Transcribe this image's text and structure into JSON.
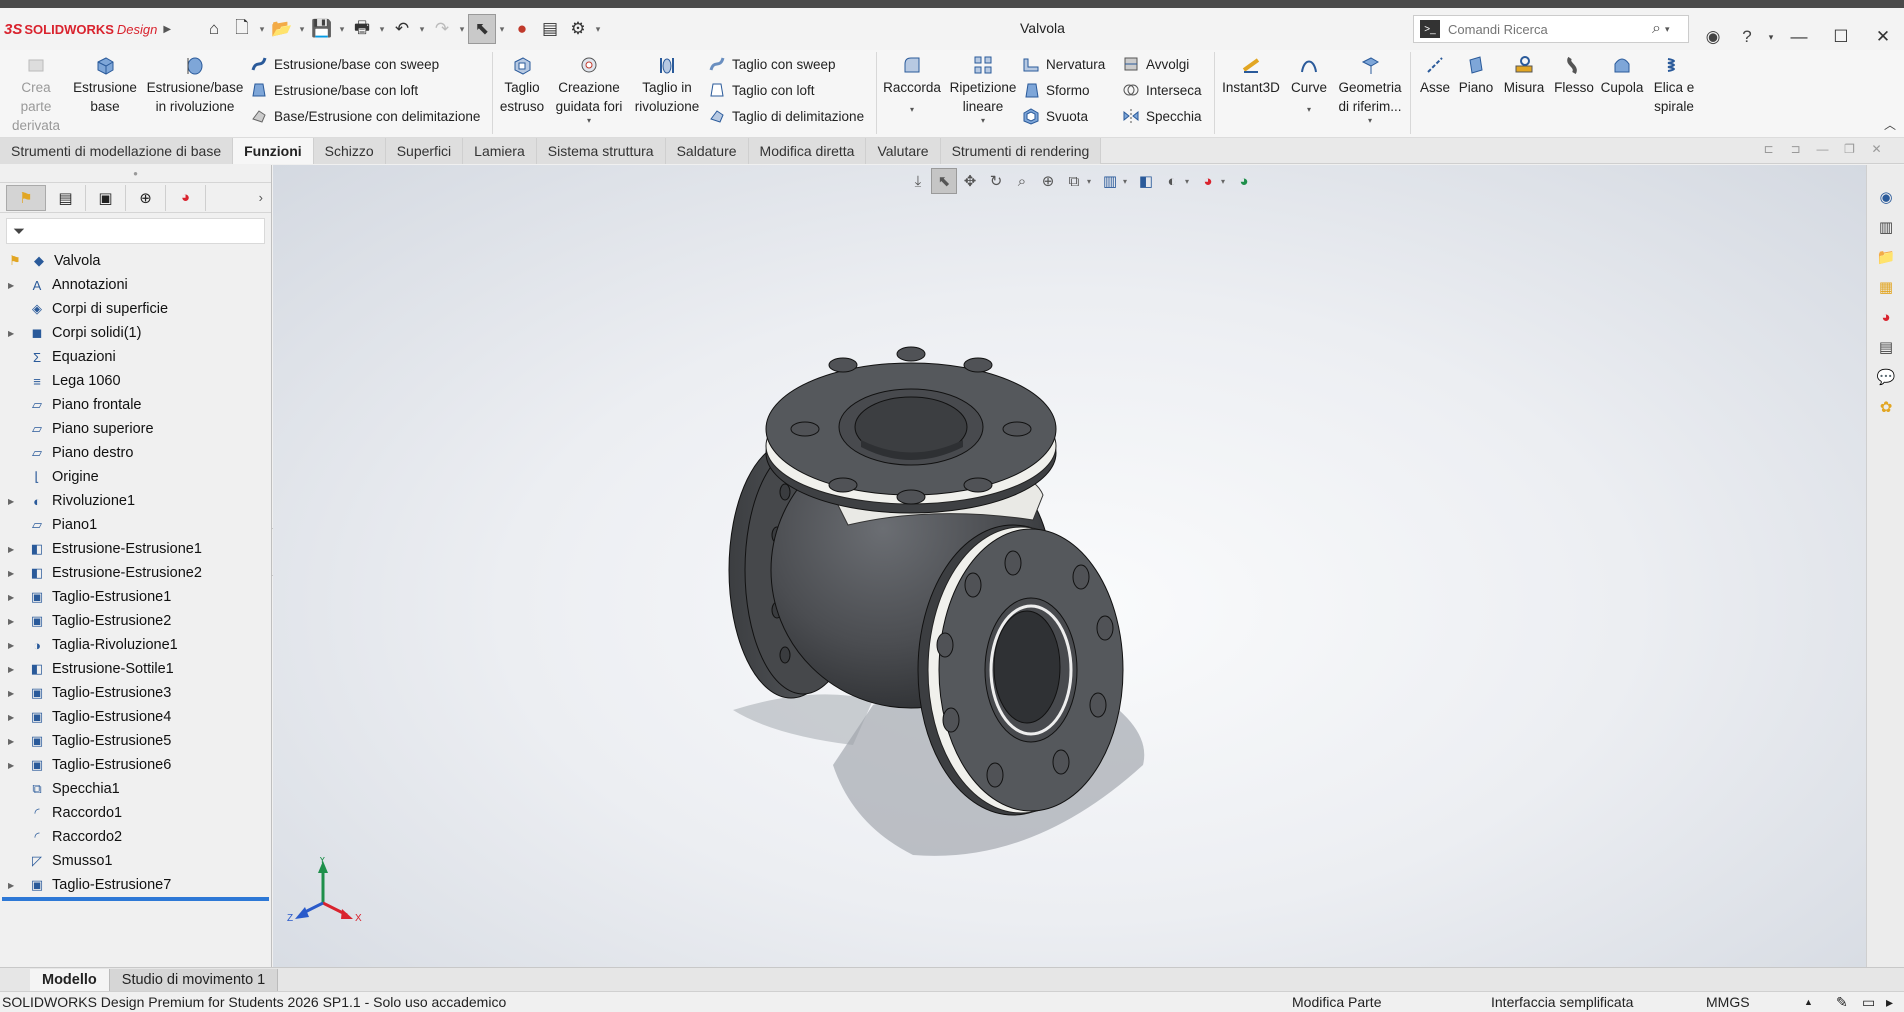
{
  "app": {
    "brand_mark": "3S",
    "brand_name": "SOLIDWORKS",
    "brand_edition": "Design",
    "document_title": "Valvola"
  },
  "search": {
    "placeholder": "Comandi Ricerca"
  },
  "ribbon": {
    "crea_parte": "Crea parte derivata",
    "estrusione_base": "Estrusione base",
    "estrusione_rivoluzione": "Estrusione/base in rivoluzione",
    "estrusione_sweep": "Estrusione/base con sweep",
    "estrusione_loft": "Estrusione/base con loft",
    "base_delimitazione": "Base/Estrusione con delimitazione",
    "taglio_estruso": "Taglio estruso",
    "creazione_fori": "Creazione guidata fori",
    "taglio_rivoluzione": "Taglio in rivoluzione",
    "taglio_sweep": "Taglio con sweep",
    "taglio_loft": "Taglio con loft",
    "taglio_delimitazione": "Taglio di delimitazione",
    "raccorda": "Raccorda",
    "ripetizione_lineare": "Ripetizione lineare",
    "nervatura": "Nervatura",
    "sformo": "Sformo",
    "svuota": "Svuota",
    "avvolgi": "Avvolgi",
    "interseca": "Interseca",
    "specchia": "Specchia",
    "instant3d": "Instant3D",
    "curve": "Curve",
    "geometria_riferimento": "Geometria di riferim...",
    "asse": "Asse",
    "piano": "Piano",
    "misura": "Misura",
    "flesso": "Flesso",
    "cupola": "Cupola",
    "elica_spirale": "Elica e spirale"
  },
  "tabs": [
    {
      "label": "Strumenti di modellazione di base",
      "active": false
    },
    {
      "label": "Funzioni",
      "active": true
    },
    {
      "label": "Schizzo",
      "active": false
    },
    {
      "label": "Superfici",
      "active": false
    },
    {
      "label": "Lamiera",
      "active": false
    },
    {
      "label": "Sistema struttura",
      "active": false
    },
    {
      "label": "Saldature",
      "active": false
    },
    {
      "label": "Modifica diretta",
      "active": false
    },
    {
      "label": "Valutare",
      "active": false
    },
    {
      "label": "Strumenti di rendering",
      "active": false
    }
  ],
  "tree": {
    "root": "Valvola",
    "items": [
      {
        "label": "Annotazioni",
        "expandable": true,
        "icon": "annotation-icon"
      },
      {
        "label": "Corpi di superficie",
        "expandable": false,
        "icon": "surface-body-icon"
      },
      {
        "label": "Corpi solidi(1)",
        "expandable": true,
        "icon": "solid-body-icon"
      },
      {
        "label": "Equazioni",
        "expandable": false,
        "icon": "equation-icon"
      },
      {
        "label": "Lega 1060",
        "expandable": false,
        "icon": "material-icon"
      },
      {
        "label": "Piano frontale",
        "expandable": false,
        "icon": "plane-icon"
      },
      {
        "label": "Piano superiore",
        "expandable": false,
        "icon": "plane-icon"
      },
      {
        "label": "Piano destro",
        "expandable": false,
        "icon": "plane-icon"
      },
      {
        "label": "Origine",
        "expandable": false,
        "icon": "origin-icon"
      },
      {
        "label": "Rivoluzione1",
        "expandable": true,
        "icon": "revolve-icon"
      },
      {
        "label": "Piano1",
        "expandable": false,
        "icon": "plane-icon"
      },
      {
        "label": "Estrusione-Estrusione1",
        "expandable": true,
        "icon": "extrude-icon"
      },
      {
        "label": "Estrusione-Estrusione2",
        "expandable": true,
        "icon": "extrude-icon"
      },
      {
        "label": "Taglio-Estrusione1",
        "expandable": true,
        "icon": "cut-extrude-icon"
      },
      {
        "label": "Taglio-Estrusione2",
        "expandable": true,
        "icon": "cut-extrude-icon"
      },
      {
        "label": "Taglia-Rivoluzione1",
        "expandable": true,
        "icon": "cut-revolve-icon"
      },
      {
        "label": "Estrusione-Sottile1",
        "expandable": true,
        "icon": "extrude-icon"
      },
      {
        "label": "Taglio-Estrusione3",
        "expandable": true,
        "icon": "cut-extrude-icon"
      },
      {
        "label": "Taglio-Estrusione4",
        "expandable": true,
        "icon": "cut-extrude-icon"
      },
      {
        "label": "Taglio-Estrusione5",
        "expandable": true,
        "icon": "cut-extrude-icon"
      },
      {
        "label": "Taglio-Estrusione6",
        "expandable": true,
        "icon": "cut-extrude-icon"
      },
      {
        "label": "Specchia1",
        "expandable": false,
        "icon": "mirror-icon"
      },
      {
        "label": "Raccordo1",
        "expandable": false,
        "icon": "fillet-icon"
      },
      {
        "label": "Raccordo2",
        "expandable": false,
        "icon": "fillet-icon"
      },
      {
        "label": "Smusso1",
        "expandable": false,
        "icon": "chamfer-icon"
      },
      {
        "label": "Taglio-Estrusione7",
        "expandable": true,
        "icon": "cut-extrude-icon"
      }
    ]
  },
  "triad": {
    "x": "X",
    "y": "Y",
    "z": "Z"
  },
  "bottom_tabs": [
    {
      "label": "Modello",
      "active": true
    },
    {
      "label": "Studio di movimento 1",
      "active": false
    }
  ],
  "status": {
    "product": "SOLIDWORKS Design Premium for Students 2026 SP1.1 - Solo uso accademico",
    "mode": "Modifica Parte",
    "interface": "Interfaccia semplificata",
    "units": "MMGS"
  },
  "colors": {
    "brand_red": "#d9232e",
    "rollback_blue": "#2d78d6",
    "model_dark": "#4b4d51"
  }
}
